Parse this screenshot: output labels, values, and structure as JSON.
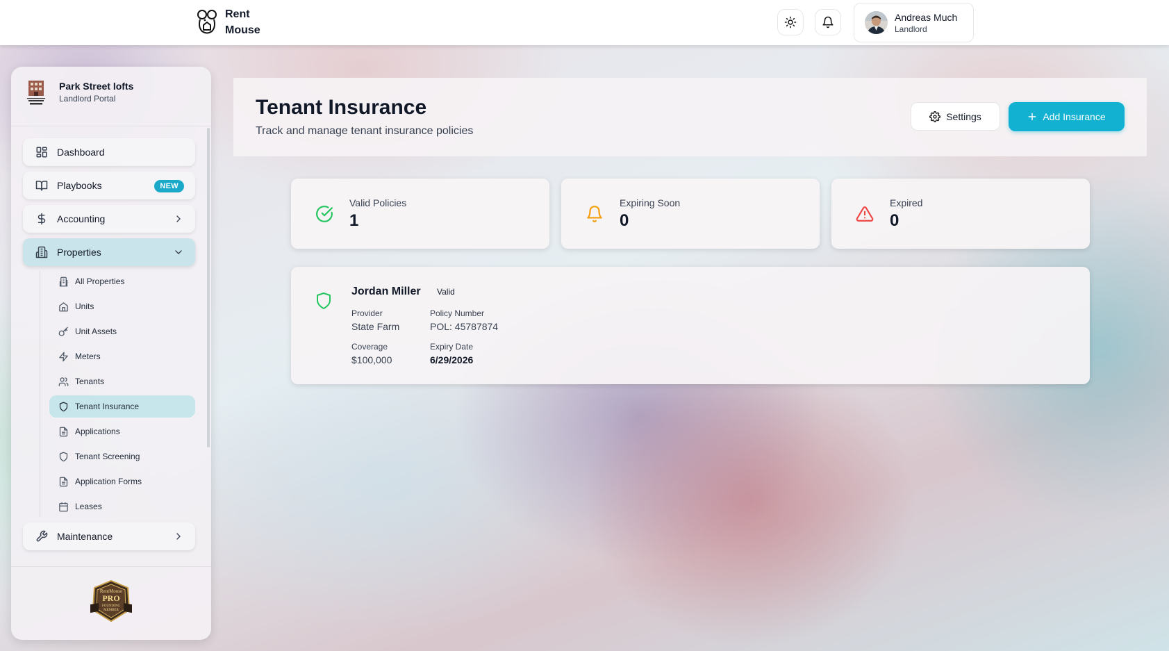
{
  "app": {
    "brand_line1": "Rent",
    "brand_line2": "Mouse"
  },
  "user": {
    "name": "Andreas Much",
    "role": "Landlord"
  },
  "topbar": {
    "theme_icon": "sun-icon",
    "notifications_icon": "bell-icon"
  },
  "sidebar": {
    "org_name": "Park Street lofts",
    "org_subtitle": "Landlord Portal",
    "items": [
      {
        "label": "Dashboard",
        "icon": "dashboard-grid-icon"
      },
      {
        "label": "Playbooks",
        "icon": "book-open-icon",
        "badge": "NEW"
      },
      {
        "label": "Accounting",
        "icon": "dollar-icon"
      },
      {
        "label": "Properties",
        "icon": "building-icon"
      },
      {
        "label": "Maintenance",
        "icon": "wrench-icon"
      }
    ],
    "sub_items": [
      {
        "label": "All Properties",
        "icon": "building-icon"
      },
      {
        "label": "Units",
        "icon": "home-icon"
      },
      {
        "label": "Unit Assets",
        "icon": "key-icon"
      },
      {
        "label": "Meters",
        "icon": "lightning-icon"
      },
      {
        "label": "Tenants",
        "icon": "users-icon"
      },
      {
        "label": "Tenant Insurance",
        "icon": "shield-icon"
      },
      {
        "label": "Applications",
        "icon": "document-icon"
      },
      {
        "label": "Tenant Screening",
        "icon": "shield-icon"
      },
      {
        "label": "Application Forms",
        "icon": "document-icon"
      },
      {
        "label": "Leases",
        "icon": "calendar-icon"
      }
    ],
    "footer_badge": {
      "line1": "RentMouse",
      "line2": "PRO",
      "line3": "FOUNDING",
      "line4": "MEMBER"
    }
  },
  "page": {
    "title": "Tenant Insurance",
    "subtitle": "Track and manage tenant insurance policies",
    "settings_label": "Settings",
    "add_label": "Add Insurance"
  },
  "stats": [
    {
      "label": "Valid Policies",
      "value": "1",
      "color": "#22c55e"
    },
    {
      "label": "Expiring Soon",
      "value": "0",
      "color": "#f59e0b"
    },
    {
      "label": "Expired",
      "value": "0",
      "color": "#ef4444"
    }
  ],
  "policies": [
    {
      "tenant": "Jordan Miller",
      "status": "Valid",
      "provider_label": "Provider",
      "provider": "State Farm",
      "policy_number_label": "Policy Number",
      "policy_number": "POL: 45787874",
      "coverage_label": "Coverage",
      "coverage": "$100,000",
      "expiry_label": "Expiry Date",
      "expiry": "6/29/2026"
    }
  ],
  "colors": {
    "accent": "#12b1d1",
    "active_nav": "#c9e4ea",
    "valid_green": "#22c55e"
  }
}
